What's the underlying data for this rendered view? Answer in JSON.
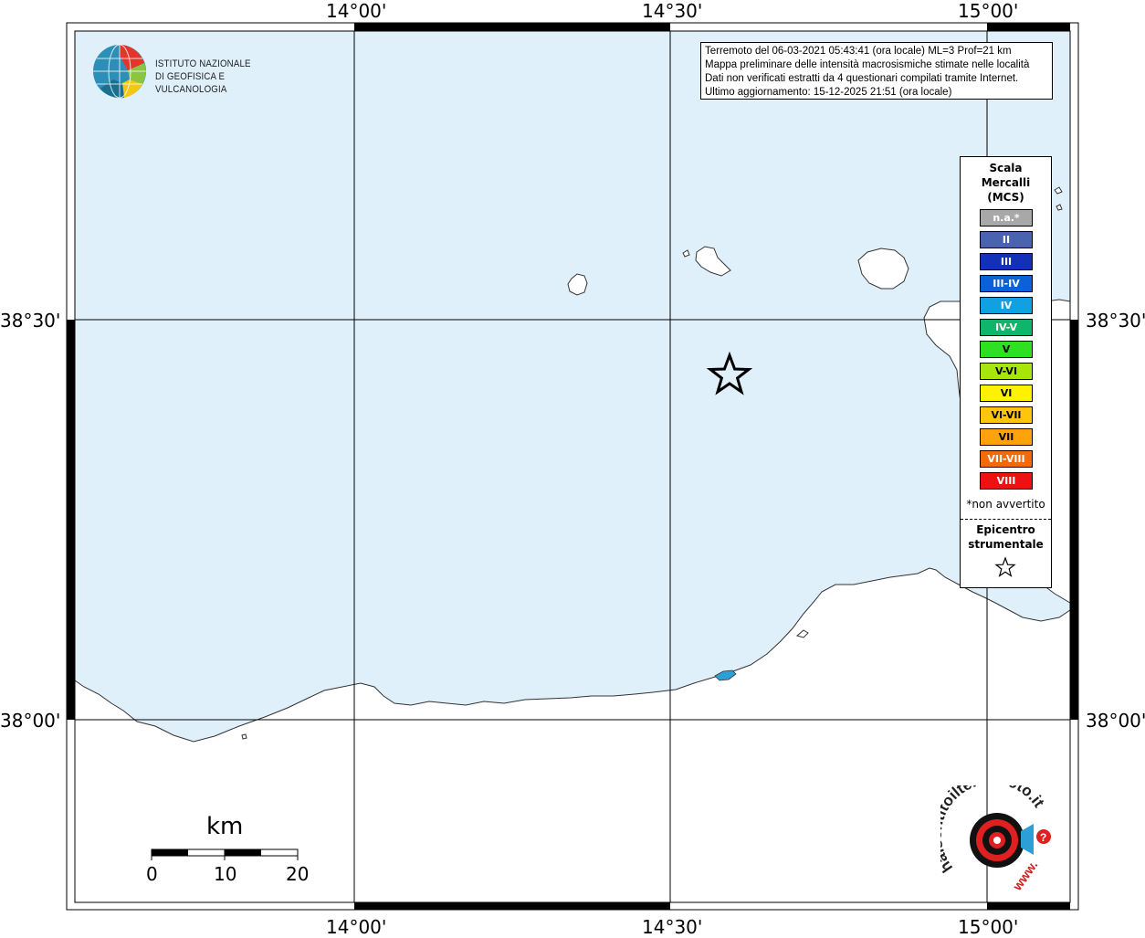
{
  "map": {
    "graticule": {
      "lon_labels": [
        "14°00'",
        "14°30'",
        "15°00'"
      ],
      "lat_labels": [
        "38°30'",
        "38°00'"
      ]
    },
    "colors": {
      "sea": "#dff0fb",
      "land": "#ffffff",
      "coast": "#333333",
      "grid": "#000000"
    }
  },
  "info": {
    "lines": [
      "Terremoto del 06-03-2021 05:43:41 (ora locale) ML=3 Prof=21 km",
      "Mappa preliminare delle intensità macrosismiche stimate nelle località",
      "Dati non verificati estratti da 4 questionari compilati tramite Internet.",
      "Ultimo aggiornamento: 15-12-2025 21:51 (ora locale)"
    ]
  },
  "logo_ingv": {
    "line1": "ISTITUTO NAZIONALE",
    "line2": "DI GEOFISICA E VULCANOLOGIA"
  },
  "legend": {
    "title_lines": [
      "Scala",
      "Mercalli",
      "(MCS)"
    ],
    "items": [
      {
        "label": "n.a.*",
        "color": "#a8a8a8"
      },
      {
        "label": "II",
        "color": "#4a63b0"
      },
      {
        "label": "III",
        "color": "#1230b8"
      },
      {
        "label": "III-IV",
        "color": "#0b62d8"
      },
      {
        "label": "IV",
        "color": "#11a1e3"
      },
      {
        "label": "IV-V",
        "color": "#0fb56b"
      },
      {
        "label": "V",
        "color": "#2ee01f"
      },
      {
        "label": "V-VI",
        "color": "#a7e60c"
      },
      {
        "label": "VI",
        "color": "#fff200"
      },
      {
        "label": "VI-VII",
        "color": "#ffc40c"
      },
      {
        "label": "VII",
        "color": "#ffa20c"
      },
      {
        "label": "VII-VIII",
        "color": "#f26a0a"
      },
      {
        "label": "VIII",
        "color": "#ee1111"
      }
    ],
    "na_note": "*non avvertito",
    "epicenter_lines": [
      "Epicentro",
      "strumentale"
    ]
  },
  "scalebar": {
    "unit": "km",
    "ticks": [
      "0",
      "10",
      "20"
    ]
  },
  "logo_hsit": {
    "text": "haisentitoilterremoto.it",
    "prefix": "www."
  }
}
